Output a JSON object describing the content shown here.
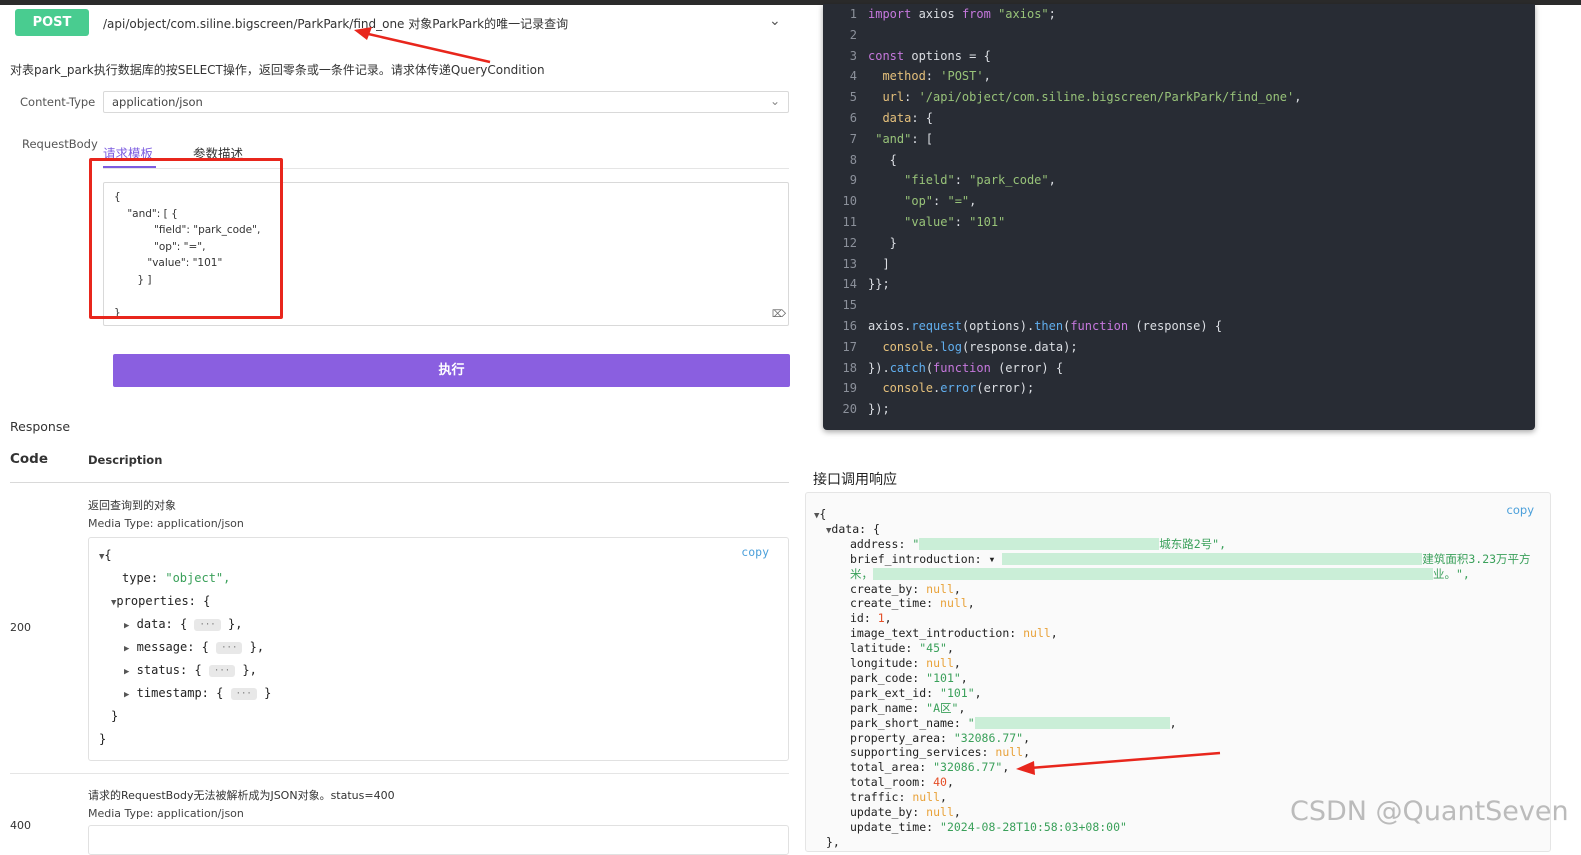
{
  "operation": {
    "method": "POST",
    "path": "/api/object/com.siline.bigscreen/ParkPark/find_one",
    "summary": "对象ParkPark的唯一记录查询",
    "description": "对表park_park执行数据库的按SELECT操作，返回零条或一条件记录。请求体传递QueryCondition"
  },
  "request": {
    "content_type_label": "Content-Type",
    "content_type_value": "application/json",
    "body_label": "RequestBody",
    "tabs": [
      "请求模板",
      "参数描述"
    ],
    "body_text": "{\n    \"and\": [ {\n            \"field\": \"park_code\",\n            \"op\": \"=\",\n          \"value\": \"101\"\n       } ]\n\n}",
    "execute_label": "执行"
  },
  "responses": {
    "title": "Response",
    "header_code": "Code",
    "header_desc": "Description",
    "r200": {
      "code": "200",
      "desc": "返回查询到的对象",
      "media": "Media Type: application/json",
      "copy": "copy",
      "schema": {
        "open_brace": "{",
        "type_key": "type:",
        "type_val": "\"object\",",
        "props_key": "properties: {",
        "items": [
          {
            "key": "data:",
            "tail": "},"
          },
          {
            "key": "message:",
            "tail": "},"
          },
          {
            "key": "status:",
            "tail": "},"
          },
          {
            "key": "timestamp:",
            "tail": "}"
          }
        ],
        "ellipsis": "···",
        "close_inner": "}",
        "close_outer": "}"
      }
    },
    "r400": {
      "code": "400",
      "desc": "请求的RequestBody无法被解析成为JSON对象。status=400",
      "media": "Media Type: application/json"
    }
  },
  "code_sample": {
    "lines": [
      [
        {
          "t": "import",
          "c": "kw"
        },
        {
          "t": " axios ",
          "c": "def"
        },
        {
          "t": "from",
          "c": "kw"
        },
        {
          "t": " ",
          "c": "def"
        },
        {
          "t": "\"axios\"",
          "c": "str"
        },
        {
          "t": ";",
          "c": "def"
        }
      ],
      [],
      [
        {
          "t": "const",
          "c": "kw"
        },
        {
          "t": " options = {",
          "c": "def"
        }
      ],
      [
        {
          "t": "  method",
          "c": "prop"
        },
        {
          "t": ": ",
          "c": "def"
        },
        {
          "t": "'POST'",
          "c": "str"
        },
        {
          "t": ",",
          "c": "def"
        }
      ],
      [
        {
          "t": "  url",
          "c": "prop"
        },
        {
          "t": ": ",
          "c": "def"
        },
        {
          "t": "'/api/object/com.siline.bigscreen/ParkPark/find_one'",
          "c": "str"
        },
        {
          "t": ",",
          "c": "def"
        }
      ],
      [
        {
          "t": "  data",
          "c": "prop"
        },
        {
          "t": ": {",
          "c": "def"
        }
      ],
      [
        {
          "t": " \"and\"",
          "c": "str"
        },
        {
          "t": ": [",
          "c": "def"
        }
      ],
      [
        {
          "t": "   {",
          "c": "def"
        }
      ],
      [
        {
          "t": "     \"field\"",
          "c": "str"
        },
        {
          "t": ": ",
          "c": "def"
        },
        {
          "t": "\"park_code\"",
          "c": "str"
        },
        {
          "t": ",",
          "c": "def"
        }
      ],
      [
        {
          "t": "     \"op\"",
          "c": "str"
        },
        {
          "t": ": ",
          "c": "def"
        },
        {
          "t": "\"=\"",
          "c": "str"
        },
        {
          "t": ",",
          "c": "def"
        }
      ],
      [
        {
          "t": "     \"value\"",
          "c": "str"
        },
        {
          "t": ": ",
          "c": "def"
        },
        {
          "t": "\"101\"",
          "c": "str"
        }
      ],
      [
        {
          "t": "   }",
          "c": "def"
        }
      ],
      [
        {
          "t": "  ]",
          "c": "def"
        }
      ],
      [
        {
          "t": "}};",
          "c": "def"
        }
      ],
      [],
      [
        {
          "t": "axios.",
          "c": "def"
        },
        {
          "t": "request",
          "c": "fn"
        },
        {
          "t": "(options).",
          "c": "def"
        },
        {
          "t": "then",
          "c": "fn"
        },
        {
          "t": "(",
          "c": "def"
        },
        {
          "t": "function",
          "c": "kw"
        },
        {
          "t": " (response) {",
          "c": "def"
        }
      ],
      [
        {
          "t": "  console",
          "c": "prop"
        },
        {
          "t": ".",
          "c": "def"
        },
        {
          "t": "log",
          "c": "fn"
        },
        {
          "t": "(response.data);",
          "c": "def"
        }
      ],
      [
        {
          "t": "}).",
          "c": "def"
        },
        {
          "t": "catch",
          "c": "fn"
        },
        {
          "t": "(",
          "c": "def"
        },
        {
          "t": "function",
          "c": "kw"
        },
        {
          "t": " (error) {",
          "c": "def"
        }
      ],
      [
        {
          "t": "  console",
          "c": "prop"
        },
        {
          "t": ".",
          "c": "def"
        },
        {
          "t": "error",
          "c": "fn"
        },
        {
          "t": "(error);",
          "c": "def"
        }
      ],
      [
        {
          "t": "});",
          "c": "def"
        }
      ]
    ]
  },
  "call_response": {
    "title": "接口调用响应",
    "copy": "copy",
    "lines": [
      {
        "indent": 0,
        "tri": "▼",
        "parts": [
          {
            "t": "{",
            "c": "d"
          }
        ]
      },
      {
        "indent": 1,
        "tri": "▼",
        "parts": [
          {
            "t": "data: {",
            "c": "d"
          }
        ]
      },
      {
        "indent": 2,
        "parts": [
          {
            "t": "address: ",
            "c": "d"
          },
          {
            "t": "\"",
            "c": "s"
          },
          {
            "redact": 240
          },
          {
            "t": "城东路2号\",",
            "c": "s"
          }
        ]
      },
      {
        "indent": 2,
        "parts": [
          {
            "t": "brief_introduction: ",
            "c": "d"
          },
          {
            "t": "▾ ",
            "c": "d"
          },
          {
            "redact": 420
          },
          {
            "t": "建筑面积3.23万平方",
            "c": "s"
          }
        ]
      },
      {
        "indent": 2,
        "outdent": true,
        "parts": [
          {
            "t": "米，",
            "c": "s"
          },
          {
            "redact": 560
          },
          {
            "t": "业。\",",
            "c": "s"
          }
        ]
      },
      {
        "indent": 2,
        "parts": [
          {
            "t": "create_by: ",
            "c": "d"
          },
          {
            "t": "null",
            "c": "n"
          },
          {
            "t": ",",
            "c": "d"
          }
        ]
      },
      {
        "indent": 2,
        "parts": [
          {
            "t": "create_time: ",
            "c": "d"
          },
          {
            "t": "null",
            "c": "n"
          },
          {
            "t": ",",
            "c": "d"
          }
        ]
      },
      {
        "indent": 2,
        "parts": [
          {
            "t": "id: ",
            "c": "d"
          },
          {
            "t": "1",
            "c": "m"
          },
          {
            "t": ",",
            "c": "d"
          }
        ]
      },
      {
        "indent": 2,
        "parts": [
          {
            "t": "image_text_introduction: ",
            "c": "d"
          },
          {
            "t": "null",
            "c": "n"
          },
          {
            "t": ",",
            "c": "d"
          }
        ]
      },
      {
        "indent": 2,
        "parts": [
          {
            "t": "latitude: ",
            "c": "d"
          },
          {
            "t": "\"45\"",
            "c": "s"
          },
          {
            "t": ",",
            "c": "d"
          }
        ]
      },
      {
        "indent": 2,
        "parts": [
          {
            "t": "longitude: ",
            "c": "d"
          },
          {
            "t": "null",
            "c": "n"
          },
          {
            "t": ",",
            "c": "d"
          }
        ]
      },
      {
        "indent": 2,
        "parts": [
          {
            "t": "park_code: ",
            "c": "d"
          },
          {
            "t": "\"101\"",
            "c": "s"
          },
          {
            "t": ",",
            "c": "d"
          }
        ]
      },
      {
        "indent": 2,
        "parts": [
          {
            "t": "park_ext_id: ",
            "c": "d"
          },
          {
            "t": "\"101\"",
            "c": "s"
          },
          {
            "t": ",",
            "c": "d"
          }
        ]
      },
      {
        "indent": 2,
        "parts": [
          {
            "t": "park_name: ",
            "c": "d"
          },
          {
            "t": "\"A区\"",
            "c": "s"
          },
          {
            "t": ",",
            "c": "d"
          }
        ]
      },
      {
        "indent": 2,
        "parts": [
          {
            "t": "park_short_name: ",
            "c": "d"
          },
          {
            "t": "\"",
            "c": "s"
          },
          {
            "redact": 195
          },
          {
            "t": ",",
            "c": "d"
          }
        ]
      },
      {
        "indent": 2,
        "parts": [
          {
            "t": "property_area: ",
            "c": "d"
          },
          {
            "t": "\"32086.77\"",
            "c": "s"
          },
          {
            "t": ",",
            "c": "d"
          }
        ]
      },
      {
        "indent": 2,
        "parts": [
          {
            "t": "supporting_services: ",
            "c": "d"
          },
          {
            "t": "null",
            "c": "n"
          },
          {
            "t": ",",
            "c": "d"
          }
        ]
      },
      {
        "indent": 2,
        "parts": [
          {
            "t": "total_area: ",
            "c": "d"
          },
          {
            "t": "\"32086.77\"",
            "c": "s"
          },
          {
            "t": ",",
            "c": "d"
          }
        ]
      },
      {
        "indent": 2,
        "parts": [
          {
            "t": "total_room: ",
            "c": "d"
          },
          {
            "t": "40",
            "c": "m"
          },
          {
            "t": ",",
            "c": "d"
          }
        ]
      },
      {
        "indent": 2,
        "parts": [
          {
            "t": "traffic: ",
            "c": "d"
          },
          {
            "t": "null",
            "c": "n"
          },
          {
            "t": ",",
            "c": "d"
          }
        ]
      },
      {
        "indent": 2,
        "parts": [
          {
            "t": "update_by: ",
            "c": "d"
          },
          {
            "t": "null",
            "c": "n"
          },
          {
            "t": ",",
            "c": "d"
          }
        ]
      },
      {
        "indent": 2,
        "parts": [
          {
            "t": "update_time: ",
            "c": "d"
          },
          {
            "t": "\"2024-08-28T10:58:03+08:00\"",
            "c": "s"
          }
        ]
      },
      {
        "indent": 1,
        "parts": [
          {
            "t": "},",
            "c": "d"
          }
        ]
      }
    ]
  },
  "watermark": "CSDN @QuantSeven",
  "colors": {
    "post_green": "#49cc90",
    "accent_purple": "#7c5ce0",
    "execute_button": "#8a5fe0",
    "annotation_red": "#e8261c",
    "code_bg": "#282c34"
  }
}
